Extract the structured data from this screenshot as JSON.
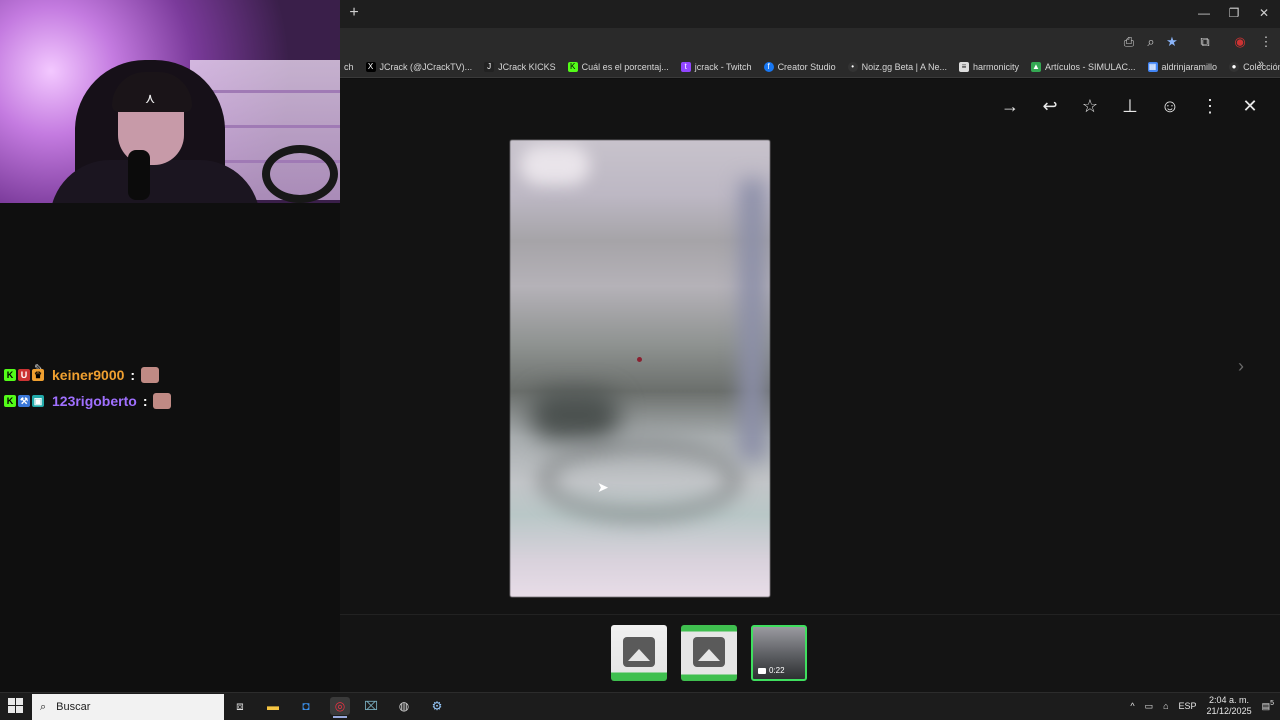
{
  "browser": {
    "bookmarks": [
      {
        "label": "ch",
        "icon": "twitch-icon",
        "color": "#9146ff"
      },
      {
        "label": "JCrack (@JCrackTV)...",
        "icon": "x-icon",
        "color": "#000000"
      },
      {
        "label": "JCrack KICKS",
        "icon": "jcrack-icon",
        "color": "#222222"
      },
      {
        "label": "Cuál es el porcentaj...",
        "icon": "kick-icon",
        "color": "#53fc18"
      },
      {
        "label": "jcrack - Twitch",
        "icon": "twitch-icon",
        "color": "#9146ff"
      },
      {
        "label": "Creator Studio",
        "icon": "facebook-icon",
        "color": "#1877f2"
      },
      {
        "label": "Noiz.gg Beta | A Ne...",
        "icon": "noiz-icon",
        "color": "#333333"
      },
      {
        "label": "harmonicity",
        "icon": "doc-icon",
        "color": "#dddddd"
      },
      {
        "label": "Artículos - SIMULAC...",
        "icon": "drive-icon",
        "color": "#34a853"
      },
      {
        "label": "aldrinjaramillo",
        "icon": "sheet-icon",
        "color": "#4285f4"
      },
      {
        "label": "Colección de M_blei...",
        "icon": "github-icon",
        "color": "#333333"
      }
    ],
    "more_bookmarks": "»",
    "new_tab": "+"
  },
  "viewer": {
    "actions": [
      "forward-icon",
      "reply-icon",
      "star-icon",
      "pin-icon",
      "emoji-icon",
      "more-icon",
      "close-icon"
    ],
    "thumbnails": [
      {
        "kind": "image"
      },
      {
        "kind": "image"
      },
      {
        "kind": "video",
        "duration": "0:22",
        "selected": true
      }
    ]
  },
  "chat": [
    {
      "username": "keiner9000",
      "separator": ":",
      "name_color": "#f0a030"
    },
    {
      "username": "123rigoberto",
      "separator": ":",
      "name_color": "#a070ff"
    }
  ],
  "taskbar": {
    "search_placeholder": "Buscar",
    "language": "ESP",
    "time": "2:04 a. m.",
    "date": "21/12/2025",
    "notification_count": "5"
  }
}
